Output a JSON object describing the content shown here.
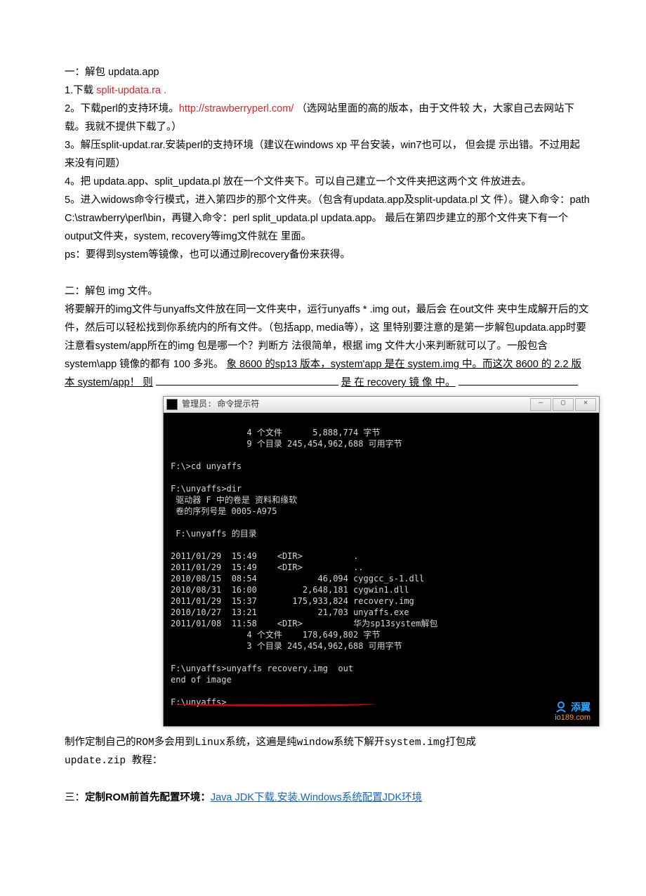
{
  "section1": {
    "heading": "一：解包  updata.app",
    "l1a": "1.下载 ",
    "l1b": "split-updata.ra .",
    "l2a": "2。下载perl的支持环境。",
    "l2b": "http://strawberryperl.com/",
    "l2c": "（选网站里面的高的版本，由于文件较 大，大家自己去网站下载。我就不提供下载了。）",
    "l3": "3。解压split-updat.rar.安装perl的支持环境（建议在windows xp 平台安装，win7也可以，  但会提 示出错。不过用起来没有问题）",
    "l4": "4。把  updata.app、split_updata.pl 放在一个文件夹下。可以自己建立一个文件夹把这两个文  件放进去。",
    "l5": "5。进入widows命令行模式，进入第四步的那个文件夹。（包含有updata.app及split-updata.pl 文 件）。键入命令：path C:\\strawberry\\perl\\bin，再键入命令：perl split_updata.pl updata.app。 最后在第四步建立的那个文件夹下有一个output文件夹，system, recovery等img文件就在  里面。",
    "ps": "ps：要得到system等镜像，也可以通过刷recovery备份来获得。"
  },
  "section2": {
    "heading": "二：解包  img 文件。",
    "body": "将要解开的img文件与unyaffs文件放在同一文件夹中，运行unyaffs * .img out，最后会  在out文件 夹中生成解开后的文件，然后可以轻松找到你系统内的所有文件。（包括app,     media等），这 里特别要注意的是第一步解包updata.app时要注意看system/app所在的img 包是哪一个？判断方 法很简单，根据  img 文件大小来判断就可以了。一般包含  system\\app 镜像的都有  100 多兆。 ",
    "ul1": "象  8600 的sp13 版本，system'app 是在  system.img 中。而这次  8600 的  2.2 版  本  system/app！    则",
    "ul2": "是  在  recovery 镜  像  中。"
  },
  "cmd": {
    "title": "管理员: 命令提示符",
    "t01": "               4 个文件      5,888,774 字节",
    "t02": "               9 个目录 245,454,962,688 可用字节",
    "t03": "",
    "t04": "F:\\>cd unyaffs",
    "t05": "",
    "t06": "F:\\unyaffs>dir",
    "t07": " 驱动器 F 中的卷是 资料和缘软",
    "t08": " 卷的序列号是 0005-A975",
    "t09": "",
    "t10": " F:\\unyaffs 的目录",
    "t11": "",
    "t12": "2011/01/29  15:49    <DIR>          .",
    "t13": "2011/01/29  15:49    <DIR>          ..",
    "t14": "2010/08/15  08:54            46,094 cyggcc_s-1.dll",
    "t15": "2010/08/31  16:00         2,648,181 cygwin1.dll",
    "t16": "2011/01/29  15:37       175,933,824 recovery.img",
    "t17": "2010/10/27  13:21            21,703 unyaffs.exe",
    "t18": "2011/01/08  11:58    <DIR>          华为sp13system解包",
    "t19": "               4 个文件    178,649,802 字节",
    "t20": "               3 个目录 245,454,962,688 可用字节",
    "t21": "",
    "t22": "F:\\unyaffs>unyaffs recovery.img  out",
    "t23": "end of image",
    "t24": "",
    "t25": "F:\\unyaffs>"
  },
  "watermark": {
    "text": "添翼",
    "sub": "io189.com"
  },
  "section2b": {
    "line1": "制作定制自己的ROM多会用到Linux系统，这遍是纯window系统下解开system.img打包成",
    "line2": "update.zip 教程："
  },
  "section3": {
    "prefix": "三：",
    "bold": "定制ROM前首先配置环境：",
    "link": "Java JDK下载.安装.Windows系统配置JDK环境"
  }
}
